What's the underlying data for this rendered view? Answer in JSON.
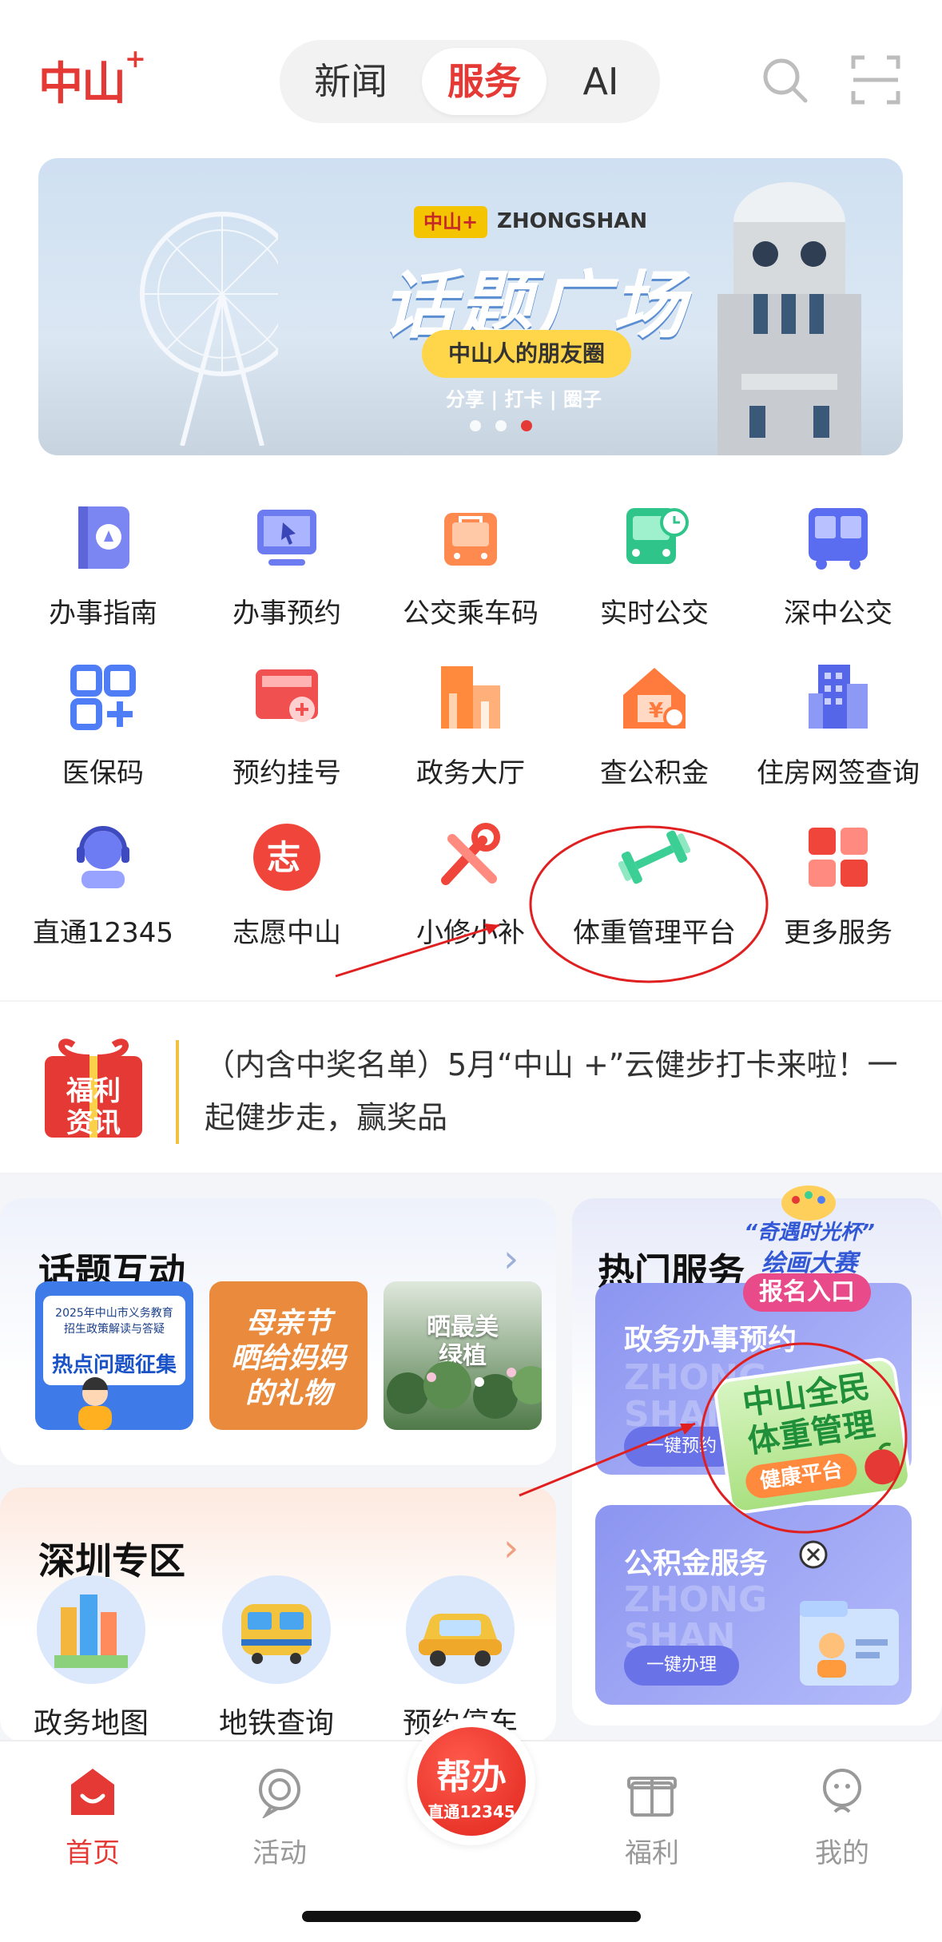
{
  "header": {
    "logo": "中山",
    "logo_plus": "+",
    "tabs": [
      "新闻",
      "服务",
      "AI"
    ],
    "active_tab": "服务"
  },
  "banner": {
    "tag": "中山+",
    "brand_en": "ZHONGSHAN",
    "title": "话题广场",
    "pill": "中山人的朋友圈",
    "subtitle": "分享 | 打卡 | 圈子",
    "slide_count": 3,
    "active_slide": 3
  },
  "services": [
    {
      "label": "办事指南",
      "icon": "guide-book-icon"
    },
    {
      "label": "办事预约",
      "icon": "monitor-cursor-icon"
    },
    {
      "label": "公交乘车码",
      "icon": "bus-code-icon"
    },
    {
      "label": "实时公交",
      "icon": "bus-clock-icon"
    },
    {
      "label": "深中公交",
      "icon": "bus-icon"
    },
    {
      "label": "医保码",
      "icon": "grid-plus-icon"
    },
    {
      "label": "预约挂号",
      "icon": "card-plus-icon"
    },
    {
      "label": "政务大厅",
      "icon": "building-icon"
    },
    {
      "label": "查公积金",
      "icon": "house-yen-icon"
    },
    {
      "label": "住房网签查询",
      "icon": "apartment-icon"
    },
    {
      "label": "直通12345",
      "icon": "headset-agent-icon"
    },
    {
      "label": "志愿中山",
      "icon": "volunteer-icon"
    },
    {
      "label": "小修小补",
      "icon": "tools-icon"
    },
    {
      "label": "体重管理平台",
      "icon": "dumbbell-icon"
    },
    {
      "label": "更多服务",
      "icon": "more-grid-icon"
    }
  ],
  "notice": {
    "badge_line1": "福利",
    "badge_line2": "资讯",
    "text": "（内含中奖名单）5月“中山 +”云健步打卡来啦！一起健步走，赢奖品"
  },
  "topic": {
    "title": "话题互动",
    "thumbs": [
      {
        "line1": "2025年中山市义务教育",
        "line2": "招生政策解读与答疑",
        "line3": "热点问题征集"
      },
      {
        "line1": "母亲节",
        "line2": "晒给妈妈",
        "line3": "的礼物"
      },
      {
        "line1": "晒最美绿植",
        "line2": "",
        "line3": ""
      }
    ]
  },
  "shenzhen": {
    "title": "深圳专区",
    "items": [
      "政务地图",
      "地铁查询",
      "预约停车"
    ]
  },
  "hot": {
    "title": "热门服务",
    "tiles": [
      {
        "title": "政务办事预约",
        "button": "一键预约"
      },
      {
        "title": "公积金服务",
        "button": "一键办理"
      }
    ],
    "watermark": "ZHONG SHAN",
    "float_top": {
      "line1": "“奇遇时光杯”",
      "line2": "绘画大赛",
      "line3": "报名入口"
    },
    "float_badge": {
      "line1": "中山全民",
      "line2": "体重管理",
      "line3": "健康平台"
    }
  },
  "tabbar": {
    "tabs": [
      "首页",
      "活动",
      "福利",
      "我的"
    ],
    "help_main": "帮办",
    "help_sub": "直通12345",
    "active": "首页"
  },
  "colors": {
    "brand_red": "#e53935",
    "annotation_red": "#e02020",
    "hot_tile_blue": "#8c95f0"
  }
}
